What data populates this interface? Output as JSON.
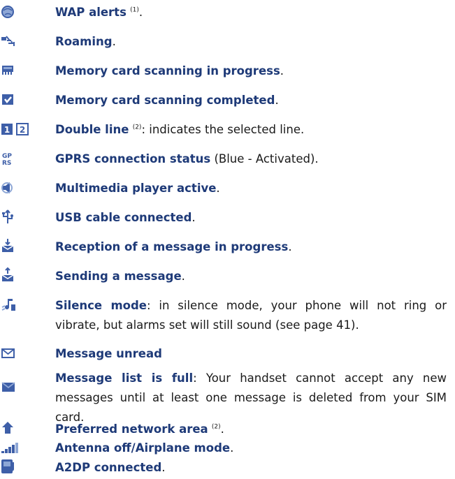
{
  "colors": {
    "heading": "#1e3a78",
    "icon": "#3e5fa8",
    "icon_light": "#8ea7d6"
  },
  "items": [
    {
      "icon": "globe-icon",
      "title": "WAP alerts",
      "sup": "(1)",
      "rest": "."
    },
    {
      "icon": "roaming-icon",
      "title": "Roaming",
      "rest": "."
    },
    {
      "icon": "memory-card-scan-icon",
      "title": "Memory card scanning in progress",
      "rest": "."
    },
    {
      "icon": "memory-card-done-icon",
      "title": "Memory card scanning completed",
      "rest": "."
    },
    {
      "icon": "double-line-icon",
      "title": "Double line",
      "sup": "(2)",
      "rest": ": indicates the selected line."
    },
    {
      "icon": "gprs-icon",
      "title": "GPRS connection status",
      "rest": " (Blue - Activated)."
    },
    {
      "icon": "speaker-icon",
      "title": "Multimedia player active",
      "rest": "."
    },
    {
      "icon": "usb-icon",
      "title": "USB cable connected",
      "rest": "."
    },
    {
      "icon": "inbox-receive-icon",
      "title": "Reception of a message in progress",
      "rest": "."
    },
    {
      "icon": "inbox-send-icon",
      "title": "Sending a message",
      "rest": "."
    },
    {
      "icon": "silence-icon",
      "title": "Silence mode",
      "rest": ": in silence mode, your phone will not ring or vibrate, but alarms set will still sound (see page 41)."
    },
    {
      "icon": "envelope-outline-icon",
      "title": "Message unread",
      "rest": ""
    },
    {
      "icon": "envelope-filled-icon",
      "title": "Message list is full",
      "rest": ": Your handset cannot accept any new messages until at least one message is deleted from your SIM card."
    },
    {
      "icon": "home-network-icon",
      "title": "Preferred network area",
      "sup": "(2)",
      "rest": "."
    },
    {
      "icon": "antenna-off-icon",
      "title": "Antenna off/Airplane mode",
      "rest": "."
    },
    {
      "icon": "a2dp-icon",
      "title": "A2DP connected",
      "rest": "."
    }
  ]
}
